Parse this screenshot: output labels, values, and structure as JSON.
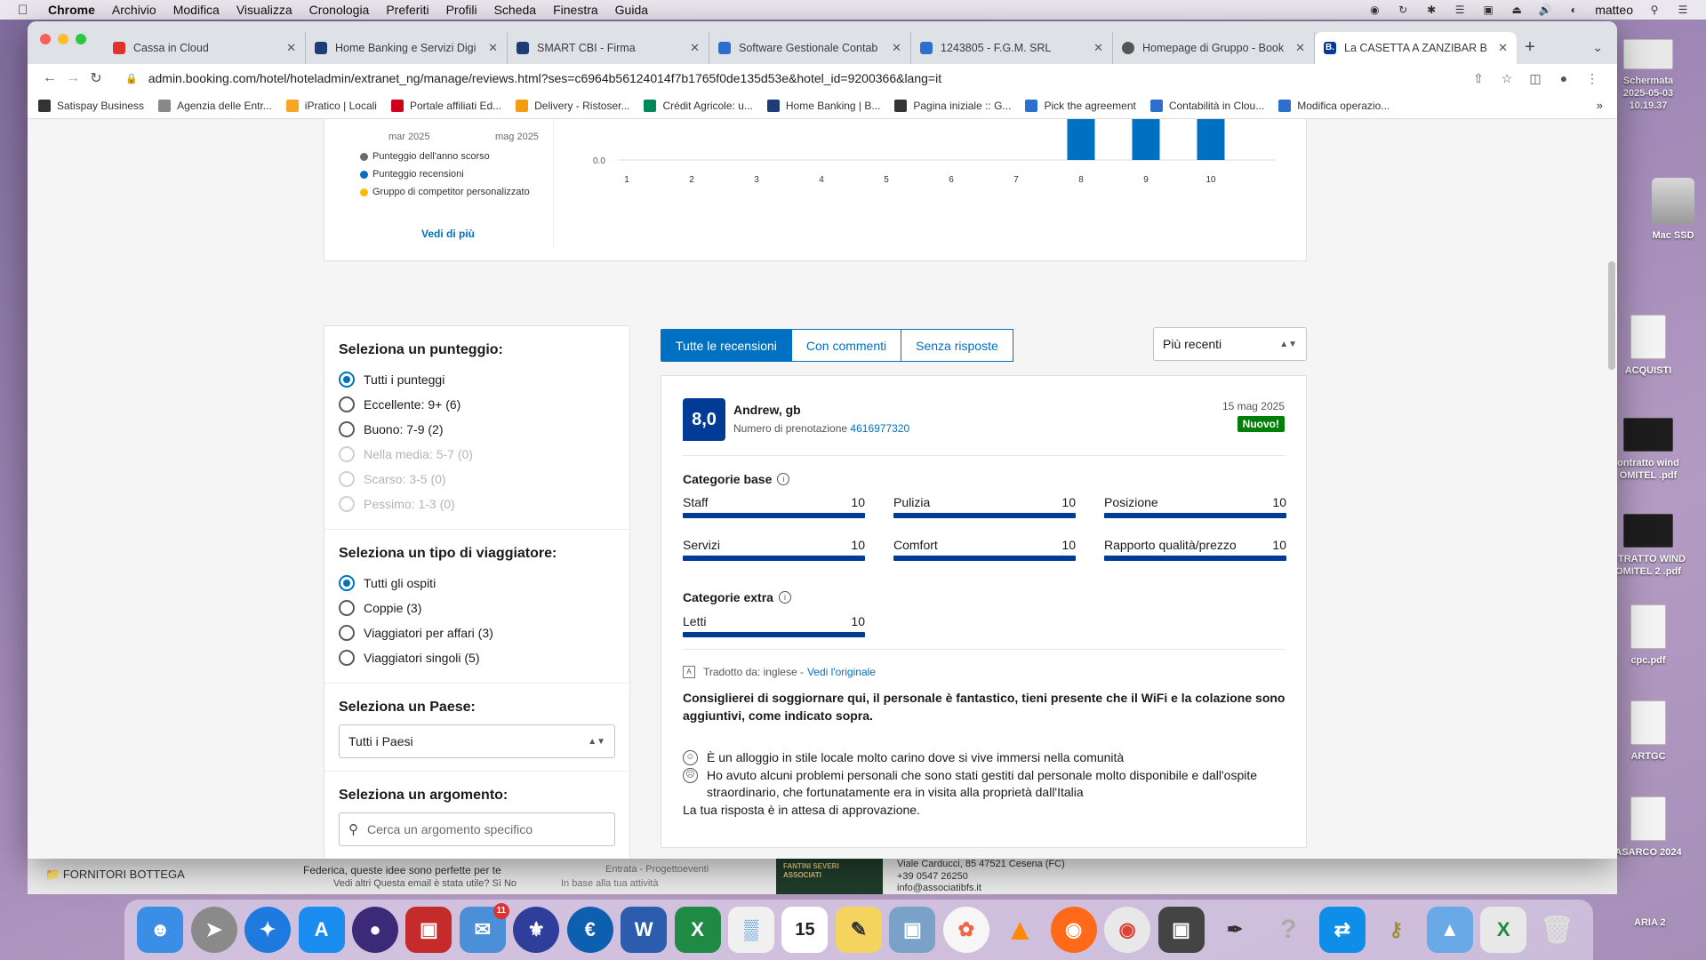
{
  "menubar": {
    "app": "Chrome",
    "items": [
      "Archivio",
      "Modifica",
      "Visualizza",
      "Cronologia",
      "Preferiti",
      "Profili",
      "Scheda",
      "Finestra",
      "Guida"
    ],
    "user": "matteo"
  },
  "tabs": [
    {
      "label": "Cassa in Cloud",
      "color": "#e0302f"
    },
    {
      "label": "Home Banking e Servizi Digi",
      "color": "#1e3c78"
    },
    {
      "label": "SMART CBI - Firma",
      "color": "#1e3c78"
    },
    {
      "label": "Software Gestionale Contab",
      "color": "#2d6fcf"
    },
    {
      "label": "1243805 - F.G.M. SRL",
      "color": "#2d6fcf"
    },
    {
      "label": "Homepage di Gruppo - Book",
      "color": "#555555"
    },
    {
      "label": "La CASETTA A ZANZIBAR B",
      "color": "#003b95",
      "icon": "B."
    }
  ],
  "address": "admin.booking.com/hotel/hoteladmin/extranet_ng/manage/reviews.html?ses=c6964b56124014f7b1765f0de135d53e&hotel_id=9200366&lang=it",
  "bookmarks": [
    {
      "label": "Satispay Business",
      "color": "#333333"
    },
    {
      "label": "Agenzia delle Entr...",
      "color": "#888888"
    },
    {
      "label": "iPratico | Locali",
      "color": "#f5a623"
    },
    {
      "label": "Portale affiliati Ed...",
      "color": "#d0021b"
    },
    {
      "label": "Delivery - Ristoser...",
      "color": "#f39c12"
    },
    {
      "label": "Crédit Agricole: u...",
      "color": "#00875a"
    },
    {
      "label": "Home Banking | B...",
      "color": "#1e3c78"
    },
    {
      "label": "Pagina iniziale :: G...",
      "color": "#333333"
    },
    {
      "label": "Pick the agreement",
      "color": "#2d6fcf"
    },
    {
      "label": "Contabilità in Clou...",
      "color": "#2d6fcf"
    },
    {
      "label": "Modifica operazio...",
      "color": "#2d6fcf"
    }
  ],
  "chart_legend": {
    "months": [
      "mar 2025",
      "mag 2025"
    ],
    "items": [
      {
        "label": "Punteggio dell'anno scorso",
        "color": "#6b6b6b"
      },
      {
        "label": "Punteggio recensioni",
        "color": "#0071c2"
      },
      {
        "label": "Gruppo di competitor personalizzato",
        "color": "#febb02"
      }
    ],
    "more_link": "Vedi di più"
  },
  "chart_data": {
    "type": "bar",
    "categories": [
      "1",
      "2",
      "3",
      "4",
      "5",
      "6",
      "7",
      "8",
      "9",
      "10"
    ],
    "values": [
      0,
      0,
      0,
      0,
      0,
      0,
      0,
      1,
      1,
      1
    ],
    "y_tick_label": "0.0",
    "color": "#0071c2"
  },
  "filters": {
    "score": {
      "title": "Seleziona un punteggio:",
      "options": [
        {
          "label": "Tutti i punteggi",
          "checked": true
        },
        {
          "label": "Eccellente: 9+ (6)"
        },
        {
          "label": "Buono: 7-9 (2)"
        },
        {
          "label": "Nella media: 5-7 (0)",
          "disabled": true
        },
        {
          "label": "Scarso: 3-5 (0)",
          "disabled": true
        },
        {
          "label": "Pessimo: 1-3 (0)",
          "disabled": true
        }
      ]
    },
    "traveler": {
      "title": "Seleziona un tipo di viaggiatore:",
      "options": [
        {
          "label": "Tutti gli ospiti",
          "checked": true
        },
        {
          "label": "Coppie (3)"
        },
        {
          "label": "Viaggiatori per affari (3)"
        },
        {
          "label": "Viaggiatori singoli (5)"
        }
      ]
    },
    "country": {
      "title": "Seleziona un Paese:",
      "value": "Tutti i Paesi"
    },
    "topic": {
      "title": "Seleziona un argomento:",
      "placeholder": "Cerca un argomento specifico"
    }
  },
  "review_tabs": [
    "Tutte le recensioni",
    "Con commenti",
    "Senza risposte"
  ],
  "sort": "Più recenti",
  "review": {
    "score": "8,0",
    "name": "Andrew, gb",
    "booking_label": "Numero di prenotazione",
    "booking_number": "4616977320",
    "date": "15 mag 2025",
    "badge": "Nuovo!",
    "base_title": "Categorie base",
    "base_categories": [
      {
        "name": "Staff",
        "value": "10"
      },
      {
        "name": "Pulizia",
        "value": "10"
      },
      {
        "name": "Posizione",
        "value": "10"
      },
      {
        "name": "Servizi",
        "value": "10"
      },
      {
        "name": "Comfort",
        "value": "10"
      },
      {
        "name": "Rapporto qualità/prezzo",
        "value": "10"
      }
    ],
    "extra_title": "Categorie extra",
    "extra_categories": [
      {
        "name": "Letti",
        "value": "10"
      }
    ],
    "translated": "Tradotto da: inglese -",
    "original_link": "Vedi l'originale",
    "title": "Consiglierei di soggiornare qui, il personale è fantastico, tieni presente che il WiFi e la colazione sono aggiuntivi, come indicato sopra.",
    "positive": "È un alloggio in stile locale molto carino dove si vive immersi nella comunità",
    "negative": "Ho avuto alcuni problemi personali che sono stati gestiti dal personale molto disponibile e dall'ospite straordinario, che fortunatamente era in visita alla proprietà dall'Italia",
    "reply_status": "La tua risposta è in attesa di approvazione."
  },
  "desktop_icons": [
    {
      "label": "Schermata 2025-05-03 10.19.37",
      "kind": "screenshot"
    },
    {
      "label": "Mac SSD",
      "kind": "disk"
    },
    {
      "label": "ACQUISTI",
      "kind": "doc"
    },
    {
      "label": "ontratto wind OMITEL .pdf",
      "kind": "dark"
    },
    {
      "label": "NTRATTO WIND OMITEL 2 .pdf",
      "kind": "dark"
    },
    {
      "label": "cpc.pdf",
      "kind": "doc"
    },
    {
      "label": "ARTGC",
      "kind": "doc"
    },
    {
      "label": "ASARCO 2024",
      "kind": "doc"
    }
  ],
  "background": {
    "folder": "FORNITORI BOTTEGA",
    "mail_line1": "Federica, queste idee sono perfette per te",
    "mail_line2": "Vedi altri   Questa email è stata utile? Sì No",
    "mail_meta1": "Entrata - Progettoeventi",
    "mail_meta2": "In base alla tua attività",
    "addr1": "Viale Carducci, 85 47521 Cesena (FC)",
    "addr2": "+39 0547 26250",
    "addr3": "info@associatibfs.it",
    "logo": "FANTINI SEVERI ASSOCIATI",
    "right_label": "ARIA 2"
  }
}
